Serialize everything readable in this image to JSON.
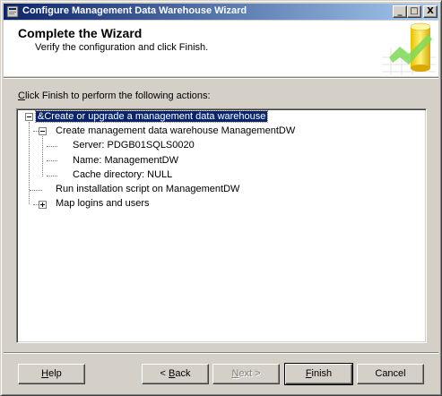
{
  "window": {
    "title": "Configure Management Data Warehouse Wizard",
    "minimize": "_",
    "maximize": "□",
    "close": "X"
  },
  "header": {
    "title": "Complete the Wizard",
    "subtitle": "Verify the configuration and click Finish."
  },
  "instruction": {
    "accel": "C",
    "rest": "lick Finish to perform the following actions:"
  },
  "tree": {
    "items": [
      {
        "label": "&Create or upgrade a management data warehouse",
        "expander": "minus",
        "selected": true
      },
      {
        "label": "Create management data warehouse ManagementDW",
        "expander": "minus"
      },
      {
        "label": "Server: PDGB01SQLS0020"
      },
      {
        "label": "Name: ManagementDW"
      },
      {
        "label": "Cache directory: NULL"
      },
      {
        "label": "Run installation script on ManagementDW"
      },
      {
        "label": "Map logins and users",
        "expander": "plus"
      }
    ]
  },
  "buttons": {
    "help": {
      "accel": "H",
      "rest": "elp"
    },
    "back": {
      "prefix": "< ",
      "accel": "B",
      "rest": "ack"
    },
    "next": {
      "accel": "N",
      "rest": "ext >"
    },
    "finish": {
      "accel": "F",
      "rest": "inish"
    },
    "cancel": {
      "label": "Cancel"
    }
  }
}
